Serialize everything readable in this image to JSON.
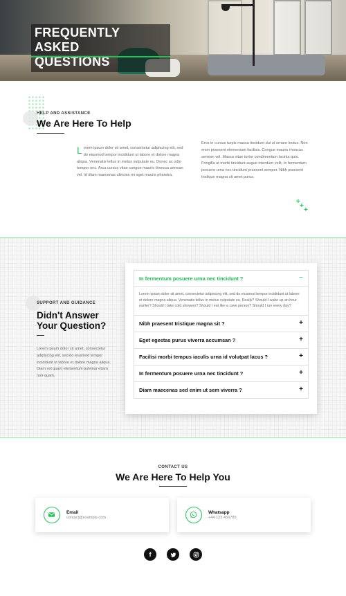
{
  "hero": {
    "title_line1": "FREQUENTLY ASKED",
    "title_line2": "QUESTIONS"
  },
  "help": {
    "eyebrow": "HELP AND ASSISTANCE",
    "heading": "We Are Here To Help",
    "drop_cap": "L",
    "col1": "orem ipsum dolor sit amet, consectetur adipiscing elit, sed do eiusmod tempor incididunt ut labore et dolore magna aliqua. Venenatis tellus in metus vulputate eu. Donec ac odio tempor orci. Arcu cursus vitae congue mauris rhoncus aenean vel. Id diam maecenas ultricies mi eget mauris pharetra.",
    "col2": "Eros in cursus turpis massa tincidunt dui ut ornare lectus. Non enim praesent elementum facilisis. Congue mauris rhoncus aenean vel. Massa vitae tortor condimentum lacinia quis. Fringilla ut morbi tincidunt augue interdum velit. In fermentum posuere urna nec tincidunt praesent semper. Nibh praesent tristique magna sit amet purus."
  },
  "support": {
    "eyebrow": "SUPPORT AND GUIDANCE",
    "heading_line1": "Didn't Answer",
    "heading_line2": "Your Question?",
    "text": "Lorem ipsum dolor sit amet, consectetur adipiscing elit, sed do eiusmod tempor incididunt ut labore et dolore magna aliqua. Diam vel quam elementum pulvinar etiam non quam."
  },
  "faq": {
    "items": [
      {
        "question": "In fermentum posuere urna nec tincidunt ?",
        "icon": "−",
        "open": true,
        "answer": "Lorem ipsum dolor sit amet, consectetur adipiscing elit, sed do eiusmod tempor incididunt ut labore et dolore magna aliqua. Venenatis tellus in metus vulputate eu. Really? Should I wake up an hour earlier? Should I take cold showers? Should I eat like a cave person? Should I run every day?"
      },
      {
        "question": "Nibh praesent tristique magna sit ?",
        "icon": "+"
      },
      {
        "question": "Eget egestas purus viverra accumsan ?",
        "icon": "+"
      },
      {
        "question": "Facilisi morbi tempus iaculis urna id volutpat lacus ?",
        "icon": "+"
      },
      {
        "question": "In fermentum posuere urna nec tincidunt ?",
        "icon": "+"
      },
      {
        "question": "Diam maecenas sed enim ut sem viverra ?",
        "icon": "+"
      }
    ]
  },
  "contact": {
    "eyebrow": "CONTACT US",
    "heading": "We Are Here To Help You",
    "cards": [
      {
        "title": "Email",
        "value": "contact@example.com",
        "icon": "envelope-icon"
      },
      {
        "title": "Whatsapp",
        "value": "+44 123 456789",
        "icon": "whatsapp-icon"
      }
    ],
    "social": [
      {
        "label": "f",
        "icon": "facebook-icon"
      },
      {
        "label": "twitter",
        "icon": "twitter-icon"
      },
      {
        "label": "instagram",
        "icon": "instagram-icon"
      }
    ]
  },
  "colors": {
    "accent": "#27c15b",
    "dark": "#111111"
  }
}
